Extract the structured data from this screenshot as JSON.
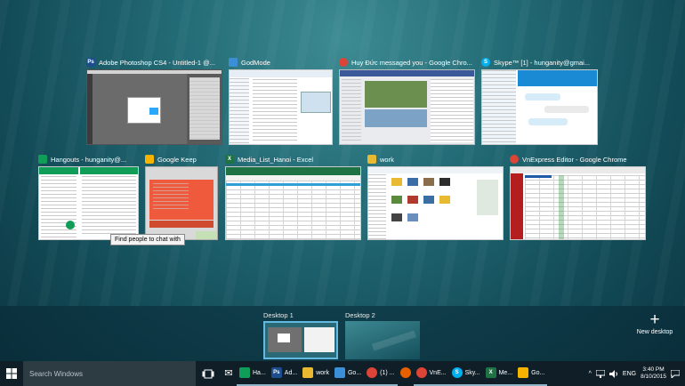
{
  "windows_row1": [
    {
      "title": "Adobe Photoshop CS4 - Untitled-1 @...",
      "icon": "Ps",
      "color": "#1c4d8c"
    },
    {
      "title": "GodMode",
      "icon": "",
      "color": "#3b8fd6"
    },
    {
      "title": "Huy Đức messaged you - Google Chro...",
      "icon": "",
      "color": "#db4437"
    },
    {
      "title": "Skype™ [1] - hunganity@gmai...",
      "icon": "S",
      "color": "#00aff0"
    }
  ],
  "windows_row2": [
    {
      "title": "Hangouts - hunganity@...",
      "icon": "",
      "color": "#0f9d58"
    },
    {
      "title": "Google Keep",
      "icon": "",
      "color": "#f6b400"
    },
    {
      "title": "Media_List_Hanoi - Excel",
      "icon": "X",
      "color": "#1f7244"
    },
    {
      "title": "work",
      "icon": "",
      "color": "#e8b931"
    },
    {
      "title": "VnExpress Editor - Google Chrome",
      "icon": "",
      "color": "#db4437"
    }
  ],
  "tooltip": "Find people to chat with",
  "desktops": {
    "d1": "Desktop 1",
    "d2": "Desktop 2",
    "new_label": "New desktop",
    "plus": "+"
  },
  "taskbar": {
    "search_placeholder": "Search Windows",
    "apps": [
      {
        "label": "",
        "icon": "✉",
        "color": "#2b5797"
      },
      {
        "label": "Ha...",
        "icon": "",
        "color": "#0f9d58"
      },
      {
        "label": "Ad...",
        "icon": "Ps",
        "color": "#1c4d8c"
      },
      {
        "label": "work",
        "icon": "",
        "color": "#e8b931"
      },
      {
        "label": "Go...",
        "icon": "",
        "color": "#3b8fd6"
      },
      {
        "label": "(1) ...",
        "icon": "",
        "color": "#db4437"
      },
      {
        "label": "",
        "icon": "",
        "color": "#e66000"
      },
      {
        "label": "VnE...",
        "icon": "",
        "color": "#db4437"
      },
      {
        "label": "Sky...",
        "icon": "S",
        "color": "#00aff0"
      },
      {
        "label": "Me...",
        "icon": "X",
        "color": "#1f7244"
      },
      {
        "label": "Go...",
        "icon": "",
        "color": "#f6b400"
      }
    ],
    "lang": "ENG",
    "time": "3:40 PM",
    "date": "8/10/2015"
  }
}
